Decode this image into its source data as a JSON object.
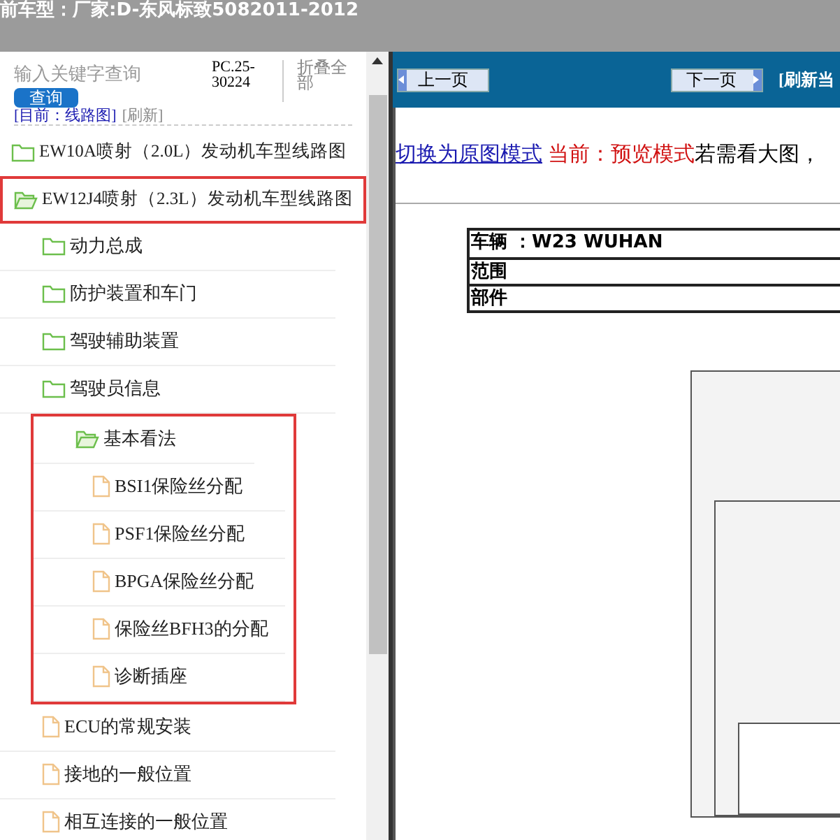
{
  "header": {
    "title": "前车型：厂家:D-东风标致5082011-2012"
  },
  "sidebar": {
    "search": {
      "placeholder": "输入关键字查询",
      "button": "查询"
    },
    "code": "PC.25-30224",
    "collapse_all": "折叠全部",
    "breadcrumb": "[目前：线路图]",
    "refresh": "[刷新]",
    "tree": [
      {
        "label": "EW10A喷射（2.0L）发动机车型线路图",
        "kind": "folder",
        "expanded": false,
        "highlighted": false
      },
      {
        "label": "EW12J4喷射（2.3L）发动机车型线路图",
        "kind": "folder",
        "expanded": true,
        "highlighted": true,
        "children": [
          {
            "label": "动力总成",
            "kind": "folder",
            "expanded": false,
            "highlighted": false
          },
          {
            "label": "防护装置和车门",
            "kind": "folder",
            "expanded": false,
            "highlighted": false
          },
          {
            "label": "驾驶辅助装置",
            "kind": "folder",
            "expanded": false,
            "highlighted": false
          },
          {
            "label": "驾驶员信息",
            "kind": "folder",
            "expanded": false,
            "highlighted": false
          },
          {
            "label": "基本看法",
            "kind": "folder",
            "expanded": true,
            "highlighted": true,
            "children": [
              {
                "label": "BSI1保险丝分配",
                "kind": "file",
                "highlighted": false
              },
              {
                "label": "PSF1保险丝分配",
                "kind": "file",
                "highlighted": false
              },
              {
                "label": "BPGA保险丝分配",
                "kind": "file",
                "highlighted": false
              },
              {
                "label": "保险丝BFH3的分配",
                "kind": "file",
                "highlighted": false
              },
              {
                "label": "诊断插座",
                "kind": "file",
                "highlighted": false
              }
            ]
          },
          {
            "label": "ECU的常规安装",
            "kind": "file",
            "highlighted": false
          },
          {
            "label": "接地的一般位置",
            "kind": "file",
            "highlighted": false
          },
          {
            "label": "相互连接的一般位置",
            "kind": "file",
            "highlighted": false
          }
        ]
      }
    ]
  },
  "viewer": {
    "prev": "上一页",
    "next": "下一页",
    "refresh": "[刷新当",
    "mode_link": "切换为原图模式",
    "mode_status": "当前：预览模式",
    "hint": "若需看大图，",
    "document": {
      "rows": [
        "车辆 ：W23 WUHAN",
        "范围",
        "部件"
      ]
    }
  }
}
